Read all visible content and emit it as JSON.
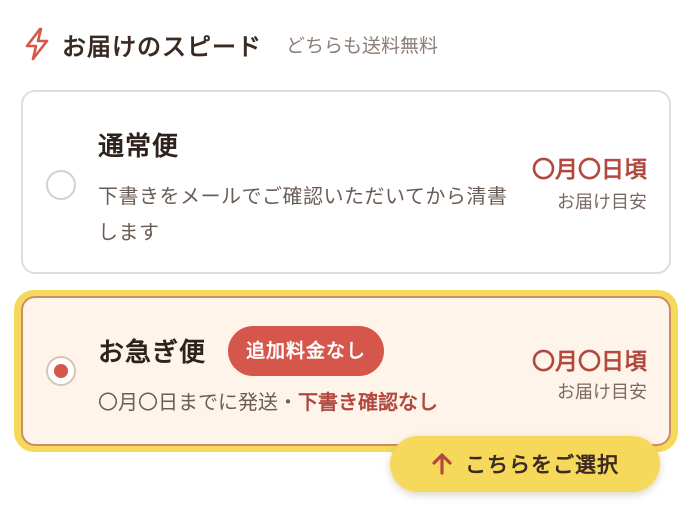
{
  "header": {
    "icon": "lightning-bolt-icon",
    "title": "お届けのスピード",
    "subtitle": "どちらも送料無料"
  },
  "options": [
    {
      "id": "normal",
      "title": "通常便",
      "description": "下書きをメールでご確認いただいてから清書します",
      "date": "〇月〇日頃",
      "date_note": "お届け目安",
      "selected": false
    },
    {
      "id": "express",
      "title": "お急ぎ便",
      "badge": "追加料金なし",
      "description_plain": "〇月〇日までに発送・",
      "description_strong": "下書き確認なし",
      "date": "〇月〇日頃",
      "date_note": "お届け目安",
      "selected": true
    }
  ],
  "cta": {
    "icon": "arrow-up-icon",
    "label": "こちらをご選択"
  },
  "colors": {
    "accent_red": "#d5564a",
    "highlight_yellow": "#f6d95a",
    "express_bg": "#fff4ea"
  }
}
